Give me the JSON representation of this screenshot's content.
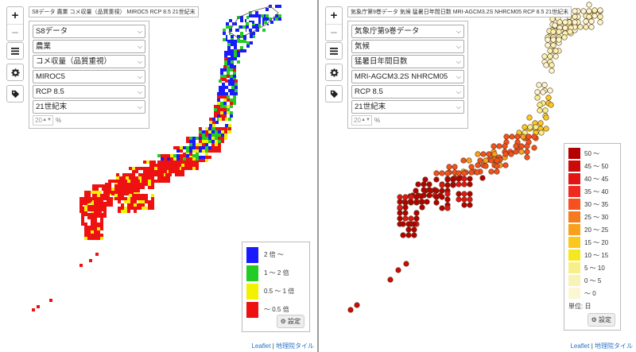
{
  "left": {
    "title": "S8データ 農業 コメ収量（品質重視） MIROC5 RCP 8.5 21世紀末",
    "zoom_in": "+",
    "zoom_out": "−",
    "selects": [
      "S8データ",
      "農業",
      "コメ収量（品質重視）",
      "MIROC5",
      "RCP 8.5",
      "21世紀末"
    ],
    "opacity_value": "20",
    "opacity_unit": "%",
    "legend": [
      {
        "label": "2 倍 ～",
        "color": "#1a1aff"
      },
      {
        "label": "1 ～ 2 倍",
        "color": "#22cc22"
      },
      {
        "label": "0.5 ～ 1 倍",
        "color": "#f2f200"
      },
      {
        "label": "～ 0.5 倍",
        "color": "#ee1111"
      }
    ],
    "settings_label": "設定"
  },
  "right": {
    "title": "気象庁第9巻データ 気候 猛暑日年間日数 MRI-AGCM3.2S NHRCM05 RCP 8.5 21世紀末",
    "zoom_in": "+",
    "zoom_out": "−",
    "selects": [
      "気象庁第9巻データ",
      "気候",
      "猛暑日年間日数",
      "MRI-AGCM3.2S NHRCM05",
      "RCP 8.5",
      "21世紀末"
    ],
    "opacity_value": "20",
    "opacity_unit": "%",
    "legend": [
      {
        "label": "50 ～",
        "color": "#b40000"
      },
      {
        "label": "45 ～ 50",
        "color": "#cc0a0a"
      },
      {
        "label": "40 ～ 45",
        "color": "#e21414"
      },
      {
        "label": "35 ～ 40",
        "color": "#f02a1e"
      },
      {
        "label": "30 ～ 35",
        "color": "#f5501e"
      },
      {
        "label": "25 ～ 30",
        "color": "#f77a1e"
      },
      {
        "label": "20 ～ 25",
        "color": "#f9a01e"
      },
      {
        "label": "15 ～ 20",
        "color": "#fcc820"
      },
      {
        "label": "10 ～ 15",
        "color": "#f6e81e"
      },
      {
        "label": "5 ～ 10",
        "color": "#f6ef8a"
      },
      {
        "label": "0 ～ 5",
        "color": "#f8f3b4"
      },
      {
        "label": "～ 0",
        "color": "#faf7d2"
      }
    ],
    "unit_label": "単位: 日",
    "settings_label": "設定"
  },
  "attribution": {
    "leaflet": "Leaflet",
    "sep": " | ",
    "gsi": "地理院タイル"
  },
  "icons": {
    "layers": "layers-icon",
    "gear": "gear-icon",
    "tag": "tag-icon"
  }
}
